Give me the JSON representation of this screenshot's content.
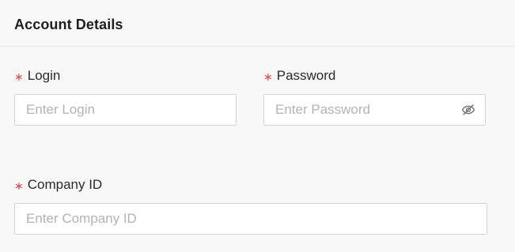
{
  "section": {
    "title": "Account Details"
  },
  "fields": {
    "login": {
      "required_mark": "∗",
      "label": "Login",
      "placeholder": "Enter Login",
      "value": ""
    },
    "password": {
      "required_mark": "∗",
      "label": "Password",
      "placeholder": "Enter Password",
      "value": "",
      "toggle_icon": "eye-slash-icon"
    },
    "company_id": {
      "required_mark": "∗",
      "label": "Company ID",
      "placeholder": "Enter Company ID",
      "value": ""
    }
  },
  "colors": {
    "required": "#e0474c",
    "border": "#d4d4d4",
    "placeholder": "#b3b3b3",
    "background": "#f8f8f8"
  }
}
